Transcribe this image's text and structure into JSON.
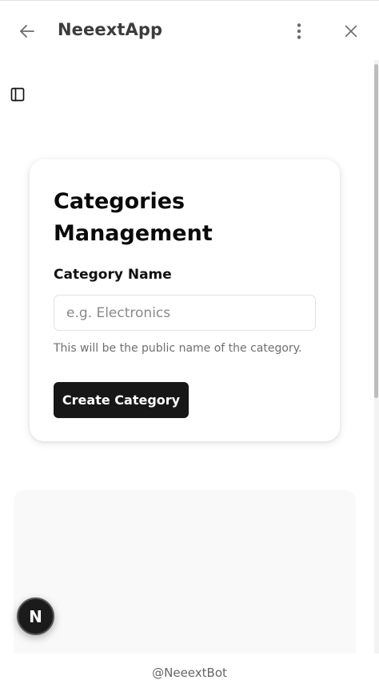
{
  "header": {
    "title": "NeeextApp",
    "back_icon": "arrow-left-icon",
    "menu_icon": "more-vertical-icon",
    "close_icon": "close-icon"
  },
  "sidebar_toggle": {
    "icon": "sidebar-panel-icon"
  },
  "card": {
    "title": "Categories Management",
    "field_label": "Category Name",
    "input_placeholder": "e.g. Electronics",
    "input_value": "",
    "help_text": "This will be the public name of the category.",
    "submit_label": "Create Category"
  },
  "fab": {
    "letter": "N"
  },
  "footer": {
    "text": "@NeeextBot"
  },
  "colors": {
    "button_bg": "#171717",
    "header_text": "#3c3c3c",
    "muted_text": "#6f6f6f",
    "panel_bg": "#f9f9f9"
  }
}
